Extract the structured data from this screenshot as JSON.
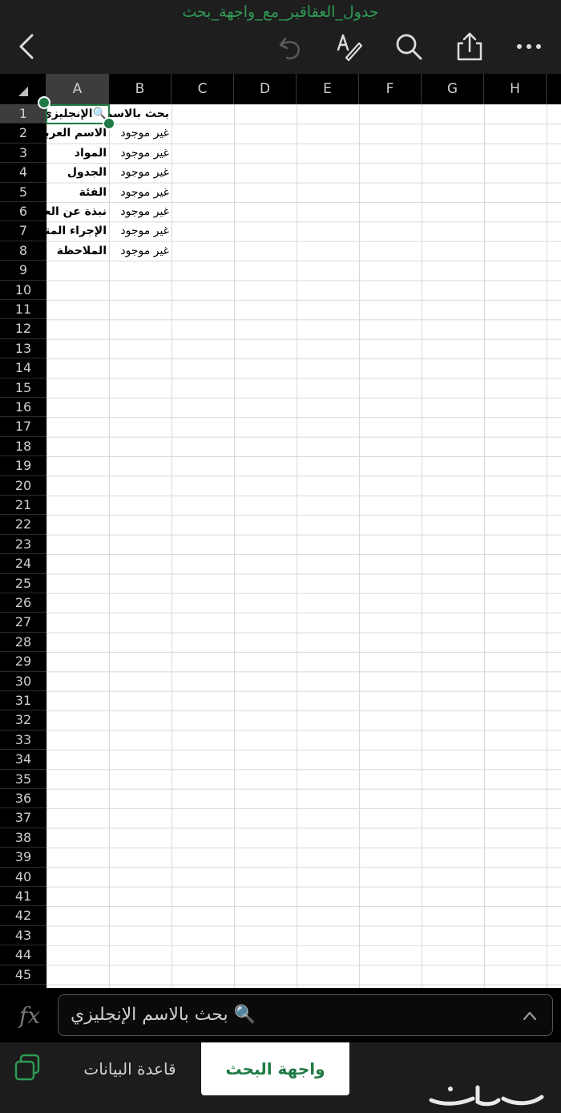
{
  "app": {
    "filename": "جدول_العقاقير_مع_واجهة_بحث"
  },
  "toolbar": {
    "back_icon": "chevron-left-icon",
    "undo_icon": "undo-icon",
    "draw_icon": "pen-text-icon",
    "search_icon": "search-icon",
    "share_icon": "share-icon",
    "more_icon": "more-horizontal-icon"
  },
  "columns": [
    "A",
    "B",
    "C",
    "D",
    "E",
    "F",
    "G",
    "H"
  ],
  "rows": [
    "1",
    "2",
    "3",
    "4",
    "5",
    "6",
    "7",
    "8",
    "9",
    "10",
    "11",
    "12",
    "13",
    "14",
    "15",
    "16",
    "17",
    "18",
    "19",
    "20",
    "21",
    "22",
    "23",
    "24",
    "25",
    "26",
    "27",
    "28",
    "29",
    "30",
    "31",
    "32",
    "33",
    "34",
    "35",
    "36",
    "37",
    "38",
    "39",
    "40",
    "41",
    "42",
    "43",
    "44",
    "45"
  ],
  "cells": {
    "A": [
      "🔍الإنجليزي",
      "الاسم العربي",
      "المواد",
      "الجدول",
      "الفئة",
      "نبذة عن العقار",
      "الإجراء المتخذ",
      "الملاحظة"
    ],
    "B": [
      "بحث بالاسم",
      "غير موجود",
      "غير موجود",
      "غير موجود",
      "غير موجود",
      "غير موجود",
      "غير موجود",
      "غير موجود"
    ]
  },
  "formula_bar": {
    "fx_label": "fx",
    "value": "🔍 بحث بالاسم الإنجليزي"
  },
  "tabs": {
    "data_sheet": "قاعدة البيانات",
    "search_sheet": "واجهة البحث"
  },
  "watermark": "حراج",
  "colors": {
    "accent": "#1f7a45",
    "filename": "#2f9a55",
    "toolbar_bg": "#1e1e1e"
  }
}
